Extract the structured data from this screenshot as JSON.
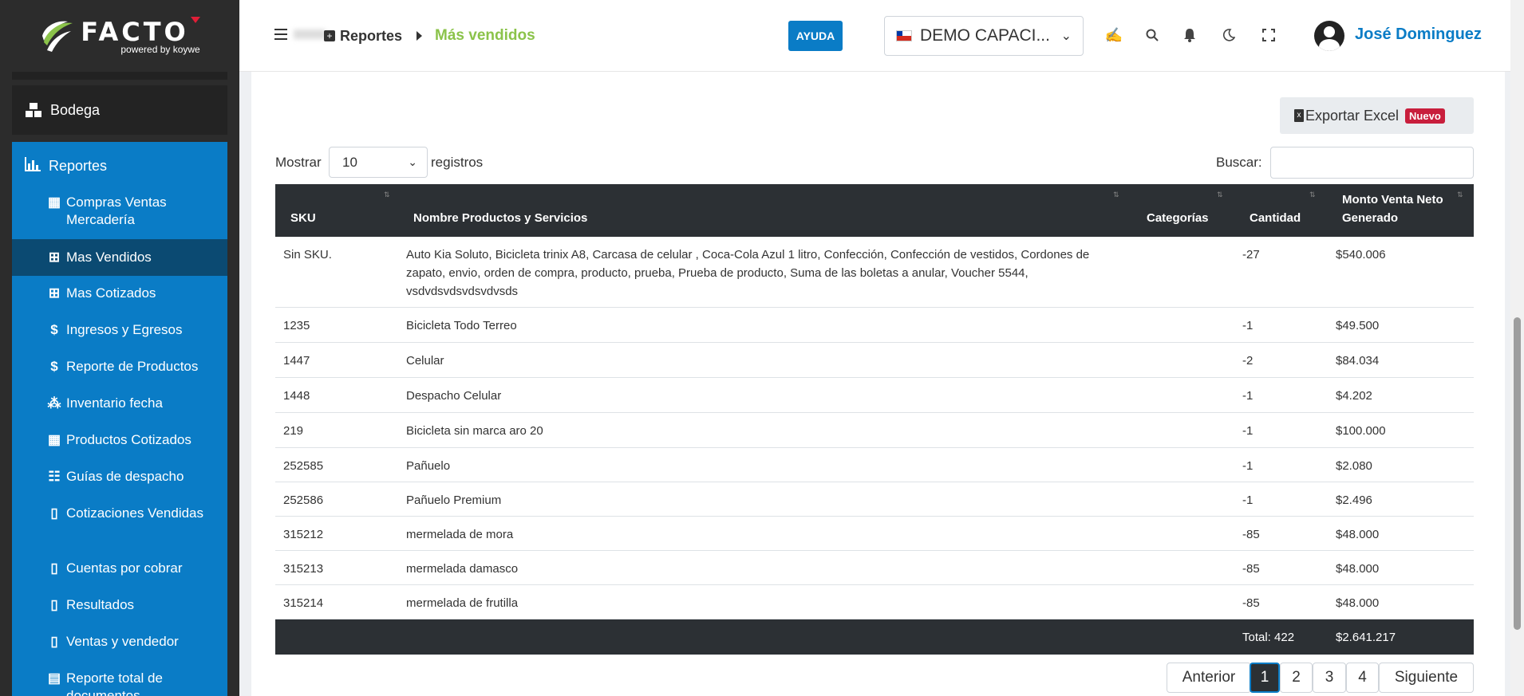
{
  "logo": {
    "brand": "FACTO",
    "powered": "powered by koywe"
  },
  "sidebar": {
    "bodega": "Bodega",
    "reportes": "Reportes",
    "items": [
      {
        "label": "Compras Ventas Mercadería",
        "icon": "calculator-icon"
      },
      {
        "label": "Mas Vendidos",
        "icon": "plus-square-icon"
      },
      {
        "label": "Mas Cotizados",
        "icon": "plus-square-icon"
      },
      {
        "label": "Ingresos y Egresos",
        "icon": "dollar-icon"
      },
      {
        "label": "Reporte de Productos",
        "icon": "dollar-icon"
      },
      {
        "label": "Inventario fecha",
        "icon": "cubes-icon"
      },
      {
        "label": "Productos Cotizados",
        "icon": "calculator-icon"
      },
      {
        "label": "Guías de despacho",
        "icon": "table-icon"
      },
      {
        "label": "Cotizaciones Vendidas",
        "icon": "file-icon"
      },
      {
        "label": "Cuentas por cobrar",
        "icon": "file-icon"
      },
      {
        "label": "Resultados",
        "icon": "file-icon"
      },
      {
        "label": "Ventas y vendedor",
        "icon": "file-icon"
      },
      {
        "label": "Reporte total de documentos",
        "icon": "archive-icon"
      }
    ]
  },
  "header": {
    "breadcrumb_parent": "Reportes",
    "breadcrumb_current": "Más vendidos",
    "help": "AYUDA",
    "company": "DEMO CAPACI...",
    "user": "José Dominguez"
  },
  "toolbar": {
    "export": "Exportar Excel",
    "export_badge": "Nuevo",
    "show_label": "Mostrar",
    "show_value": "10",
    "records_label": "registros",
    "search_label": "Buscar:",
    "search_value": ""
  },
  "table": {
    "headers": {
      "sku": "SKU",
      "name": "Nombre Productos y Servicios",
      "category": "Categorías",
      "qty": "Cantidad",
      "amount": "Monto Venta Neto Generado"
    },
    "rows": [
      {
        "sku": "Sin SKU.",
        "name": "Auto Kia Soluto, Bicicleta trinix A8, Carcasa de celular , Coca-Cola Azul 1 litro, Confección, Confección de vestidos, Cordones de zapato, envio, orden de compra, producto, prueba, Prueba de producto, Suma de las boletas a anular, Voucher 5544, vsdvdsvdsvdsvdvsds",
        "category": "",
        "qty": "-27",
        "amount": "$540.006"
      },
      {
        "sku": "1235",
        "name": "Bicicleta Todo Terreo",
        "category": "",
        "qty": "-1",
        "amount": "$49.500"
      },
      {
        "sku": "1447",
        "name": "Celular",
        "category": "",
        "qty": "-2",
        "amount": "$84.034"
      },
      {
        "sku": "1448",
        "name": "Despacho Celular",
        "category": "",
        "qty": "-1",
        "amount": "$4.202"
      },
      {
        "sku": "219",
        "name": "Bicicleta sin marca aro 20",
        "category": "",
        "qty": "-1",
        "amount": "$100.000"
      },
      {
        "sku": "252585",
        "name": "Pañuelo",
        "category": "",
        "qty": "-1",
        "amount": "$2.080"
      },
      {
        "sku": "252586",
        "name": "Pañuelo Premium",
        "category": "",
        "qty": "-1",
        "amount": "$2.496"
      },
      {
        "sku": "315212",
        "name": "mermelada de mora",
        "category": "",
        "qty": "-85",
        "amount": "$48.000"
      },
      {
        "sku": "315213",
        "name": "mermelada damasco",
        "category": "",
        "qty": "-85",
        "amount": "$48.000"
      },
      {
        "sku": "315214",
        "name": "mermelada de frutilla",
        "category": "",
        "qty": "-85",
        "amount": "$48.000"
      }
    ],
    "footer": {
      "total_qty": "Total: 422",
      "total_amount": "$2.641.217"
    }
  },
  "pagination": {
    "prev": "Anterior",
    "pages": [
      "1",
      "2",
      "3",
      "4"
    ],
    "current": "1",
    "next": "Siguiente"
  },
  "colors": {
    "primary": "#0a7cc6",
    "sidebar_dark": "#2c2c2c",
    "accent_green": "#8bc34a",
    "badge_red": "#c81e3c",
    "table_dark": "#2c3034"
  }
}
